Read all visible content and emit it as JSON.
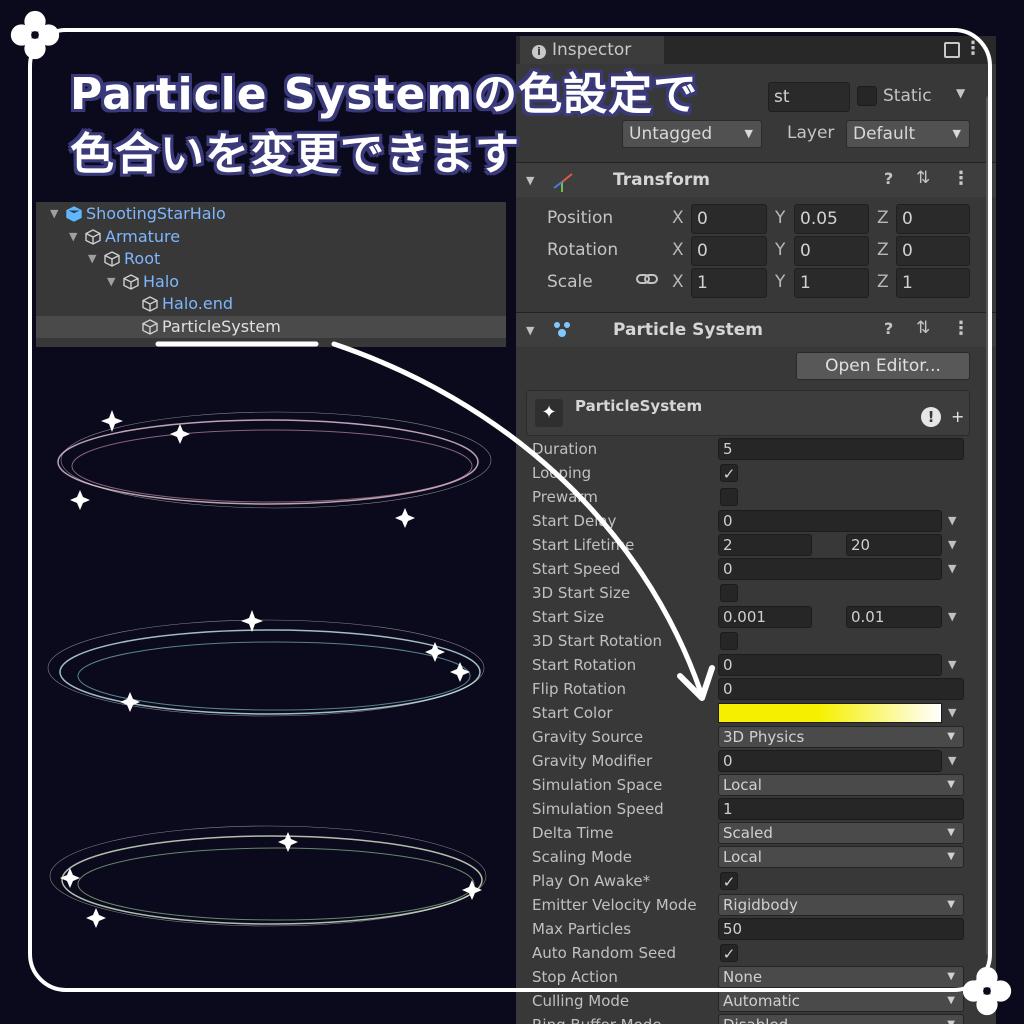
{
  "headline": {
    "line1": "Particle Systemの色設定で",
    "line2": "色合いを変更できます"
  },
  "hierarchy": {
    "items": [
      {
        "label": "ShootingStarHalo",
        "depth": 0,
        "expanded": true,
        "icon": "prefab-cube-icon"
      },
      {
        "label": "Armature",
        "depth": 1,
        "expanded": true,
        "icon": "gameobject-cube-icon"
      },
      {
        "label": "Root",
        "depth": 2,
        "expanded": true,
        "icon": "gameobject-cube-icon"
      },
      {
        "label": "Halo",
        "depth": 3,
        "expanded": true,
        "icon": "gameobject-cube-icon"
      },
      {
        "label": "Halo.end",
        "depth": 4,
        "expanded": false,
        "icon": "gameobject-cube-icon"
      },
      {
        "label": "ParticleSystem",
        "depth": 4,
        "expanded": false,
        "icon": "gameobject-cube-icon",
        "selected": true
      }
    ]
  },
  "inspector": {
    "tab_label": "Inspector",
    "object_name_partial": "st",
    "static_label": "Static",
    "tag_value": "Untagged",
    "layer_label": "Layer",
    "layer_value": "Default",
    "transform": {
      "title": "Transform",
      "rows": [
        {
          "label": "Position",
          "x": "0",
          "y": "0.05",
          "z": "0"
        },
        {
          "label": "Rotation",
          "x": "0",
          "y": "0",
          "z": "0"
        },
        {
          "label": "Scale",
          "x": "1",
          "y": "1",
          "z": "1"
        }
      ]
    },
    "particle_system": {
      "title": "Particle System",
      "open_editor": "Open Editor...",
      "module_title": "ParticleSystem",
      "start_color_hex": "#f6f000",
      "rows": [
        {
          "label": "Duration",
          "kind": "field",
          "value": "5"
        },
        {
          "label": "Looping",
          "kind": "check",
          "value": "✓"
        },
        {
          "label": "Prewarm",
          "kind": "check",
          "value": ""
        },
        {
          "label": "Start Delay",
          "kind": "field-drop",
          "value": "0"
        },
        {
          "label": "Start Lifetime",
          "kind": "two",
          "value": "2",
          "value2": "20"
        },
        {
          "label": "Start Speed",
          "kind": "field-drop",
          "value": "0"
        },
        {
          "label": "3D Start Size",
          "kind": "check",
          "value": ""
        },
        {
          "label": "Start Size",
          "kind": "two",
          "value": "0.001",
          "value2": "0.01"
        },
        {
          "label": "3D Start Rotation",
          "kind": "check",
          "value": ""
        },
        {
          "label": "Start Rotation",
          "kind": "field-drop",
          "value": "0"
        },
        {
          "label": "Flip Rotation",
          "kind": "field",
          "value": "0"
        },
        {
          "label": "Start Color",
          "kind": "color",
          "value": ""
        },
        {
          "label": "Gravity Source",
          "kind": "drop",
          "value": "3D Physics"
        },
        {
          "label": "Gravity Modifier",
          "kind": "field-drop",
          "value": "0"
        },
        {
          "label": "Simulation Space",
          "kind": "drop",
          "value": "Local"
        },
        {
          "label": "Simulation Speed",
          "kind": "field",
          "value": "1"
        },
        {
          "label": "Delta Time",
          "kind": "drop",
          "value": "Scaled"
        },
        {
          "label": "Scaling Mode",
          "kind": "drop",
          "value": "Local"
        },
        {
          "label": "Play On Awake*",
          "kind": "check",
          "value": "✓"
        },
        {
          "label": "Emitter Velocity Mode",
          "kind": "drop",
          "value": "Rigidbody"
        },
        {
          "label": "Max Particles",
          "kind": "field",
          "value": "50"
        },
        {
          "label": "Auto Random Seed",
          "kind": "check",
          "value": "✓"
        },
        {
          "label": "Stop Action",
          "kind": "drop",
          "value": "None"
        },
        {
          "label": "Culling Mode",
          "kind": "drop",
          "value": "Automatic"
        },
        {
          "label": "Ring Buffer Mode",
          "kind": "drop",
          "value": "Disabled"
        }
      ]
    }
  },
  "colors": {
    "background": "#0a0a1c",
    "accent_outline": "#3a3a7a",
    "hierarchy_text": "#7fb6ff"
  }
}
